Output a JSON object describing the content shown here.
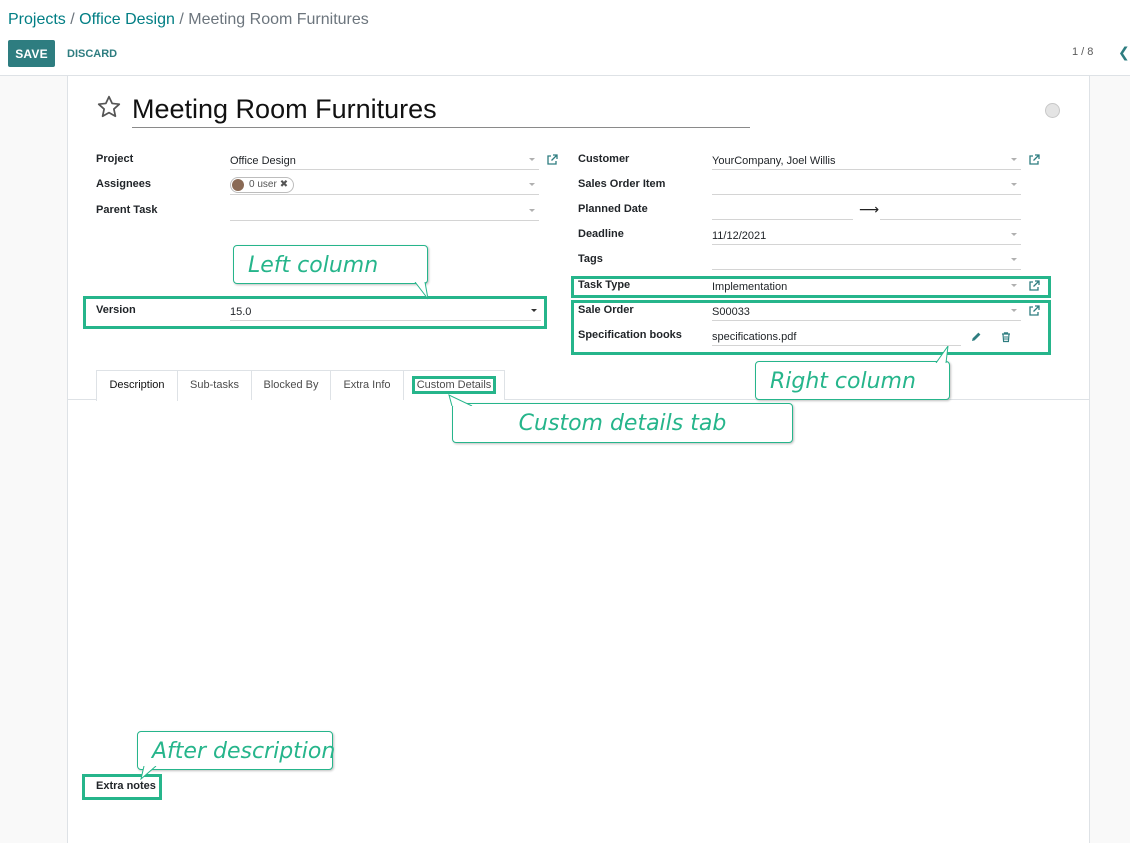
{
  "breadcrumb": {
    "items": [
      "Projects",
      "Office Design",
      "Meeting Room Furnitures"
    ],
    "separator": "/"
  },
  "toolbar": {
    "save_label": "SAVE",
    "discard_label": "DISCARD",
    "pager": "1 / 8"
  },
  "record": {
    "title": "Meeting Room Furnitures"
  },
  "left_fields": {
    "project_label": "Project",
    "project_value": "Office Design",
    "assignees_label": "Assignees",
    "assignees_tag": "0 user",
    "parent_task_label": "Parent Task",
    "version_label": "Version",
    "version_value": "15.0"
  },
  "right_fields": {
    "customer_label": "Customer",
    "customer_value": "YourCompany, Joel Willis",
    "sales_order_item_label": "Sales Order Item",
    "planned_date_label": "Planned Date",
    "deadline_label": "Deadline",
    "deadline_value": "11/12/2021",
    "tags_label": "Tags",
    "task_type_label": "Task Type",
    "task_type_value": "Implementation",
    "sale_order_label": "Sale Order",
    "sale_order_value": "S00033",
    "spec_books_label": "Specification books",
    "spec_books_value": "specifications.pdf"
  },
  "tabs": [
    "Description",
    "Sub-tasks",
    "Blocked By",
    "Extra Info",
    "Custom Details"
  ],
  "after_description_label": "Extra notes",
  "callouts": {
    "left_column": "Left column",
    "right_column": "Right column",
    "custom_details_tab": "Custom details tab",
    "after_description": "After description"
  },
  "colors": {
    "primary": "#2e7d80",
    "link": "#017e84",
    "annotation": "#26b58b"
  }
}
